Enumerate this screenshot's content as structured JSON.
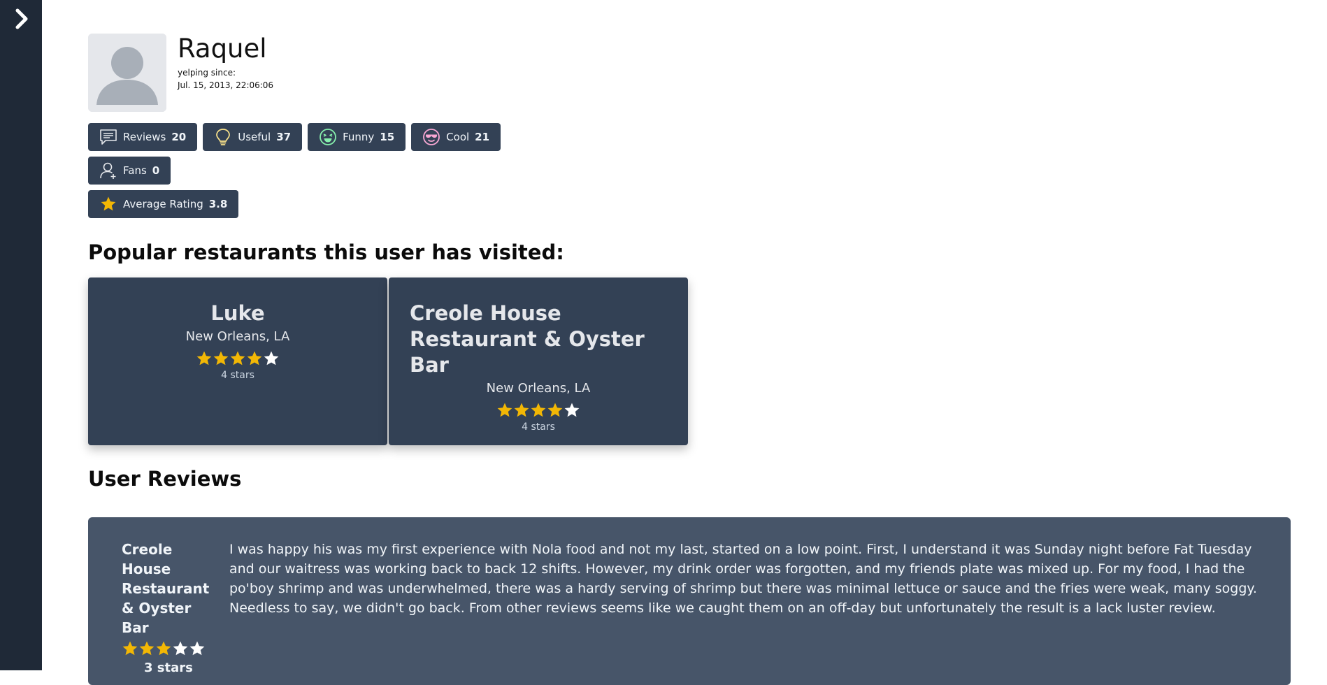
{
  "sidebar": {
    "toggle_icon": "chevron-right-icon"
  },
  "profile": {
    "name": "Raquel",
    "since_label": "yelping since:",
    "since_date": "Jul. 15, 2013, 22:06:06",
    "avatar_icon": "user-silhouette-icon"
  },
  "stats": {
    "reviews": {
      "label": "Reviews",
      "value": "20",
      "icon": "speech-bubble-icon"
    },
    "useful": {
      "label": "Useful",
      "value": "37",
      "icon": "lightbulb-icon"
    },
    "funny": {
      "label": "Funny",
      "value": "15",
      "icon": "laughing-face-icon"
    },
    "cool": {
      "label": "Cool",
      "value": "21",
      "icon": "sunglasses-face-icon"
    },
    "fans": {
      "label": "Fans",
      "value": "0",
      "icon": "user-icon"
    },
    "avg_rating": {
      "label": "Average Rating",
      "value": "3.8",
      "icon": "star-icon"
    }
  },
  "popular": {
    "title": "Popular restaurants this user has visited:",
    "cards": [
      {
        "name": "Luke",
        "location": "New Orleans, LA",
        "rating": 4,
        "rating_label": "4 stars"
      },
      {
        "name": "Creole House Restaurant & Oyster Bar",
        "location": "New Orleans, LA",
        "rating": 4,
        "rating_label": "4 stars"
      }
    ]
  },
  "reviews": {
    "title": "User Reviews",
    "items": [
      {
        "restaurant": "Creole House Restaurant & Oyster Bar",
        "rating": 3,
        "rating_label": "3 stars",
        "text": "I was happy his was my first experience with Nola food and not my last, started on a low point. First, I understand it was Sunday night before Fat Tuesday and our waitress was working back to back 12 shifts. However, my drink order was forgotten, and my friends plate was mixed up. For my food, I had the po'boy shrimp and was underwhelmed, there was a hardy serving of shrimp but there was minimal lettuce or sauce and the fries were weak, many soggy. Needless to say, we didn't go back. From other reviews seems like we caught them on an off-day but unfortunately the result is a lack luster review."
      }
    ]
  },
  "colors": {
    "star_filled": "#f2b705",
    "star_empty": "#ffffff",
    "badge_bg": "#334155",
    "sidebar_bg": "#1f2937",
    "review_bg": "#475569"
  }
}
